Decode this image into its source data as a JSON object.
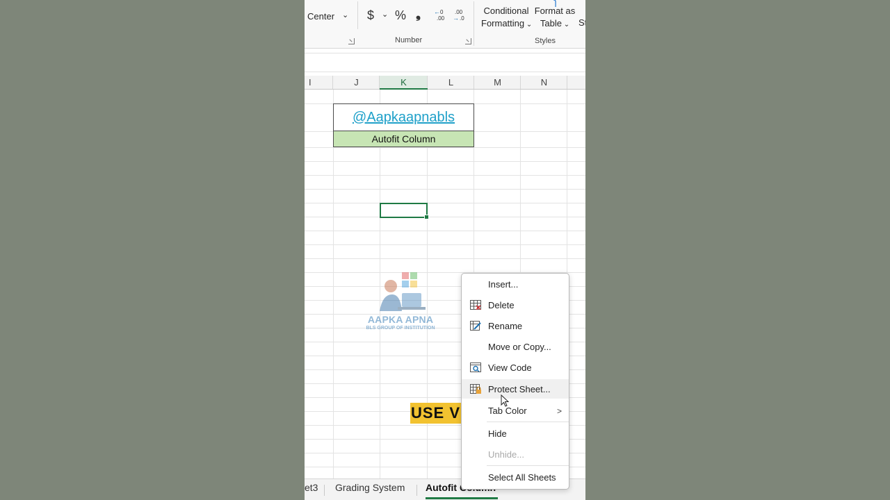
{
  "ribbon": {
    "merge_center": "Center",
    "currency_symbol": "$",
    "percent_symbol": "%",
    "comma_symbol": "❟",
    "increase_decimal": "←.0 .00",
    "decrease_decimal": ".00 →.0",
    "number_group_label": "Number",
    "conditional_formatting": [
      "Conditional",
      "Formatting"
    ],
    "format_as_table": [
      "Format as",
      "Table"
    ],
    "cell_styles_partial": "St",
    "styles_group_label": "Styles"
  },
  "columns": [
    "I",
    "J",
    "K",
    "L",
    "M",
    "N"
  ],
  "active_column": "K",
  "sheet": {
    "title_link": "@Aapkaapnabls",
    "subtitle": "Autofit Column"
  },
  "watermark": {
    "brand": "AAPKA APNA",
    "sub": "BLS GROUP OF INSTITUTION"
  },
  "banner": {
    "text": "USE VBA"
  },
  "sheet_tabs": [
    {
      "label": "et3",
      "active": false
    },
    {
      "label": "Grading System",
      "active": false
    },
    {
      "label": "Autofit Column",
      "active": true
    }
  ],
  "context_menu": {
    "items": [
      {
        "label": "Insert...",
        "state": "normal"
      },
      {
        "label": "Delete",
        "state": "normal"
      },
      {
        "label": "Rename",
        "state": "normal"
      },
      {
        "label": "Move or Copy...",
        "state": "normal"
      },
      {
        "label": "View Code",
        "state": "normal"
      },
      {
        "label": "Protect Sheet...",
        "state": "hover"
      },
      {
        "label": "Tab Color",
        "state": "normal"
      },
      {
        "label": "Hide",
        "state": "normal"
      },
      {
        "label": "Unhide...",
        "state": "disabled"
      },
      {
        "label": "Select All Sheets",
        "state": "normal"
      }
    ]
  },
  "colors": {
    "accent_green": "#1f7a44",
    "link_blue": "#1ea0c9",
    "header_fill": "#c7e5b4",
    "banner_yellow": "#f2c230"
  }
}
